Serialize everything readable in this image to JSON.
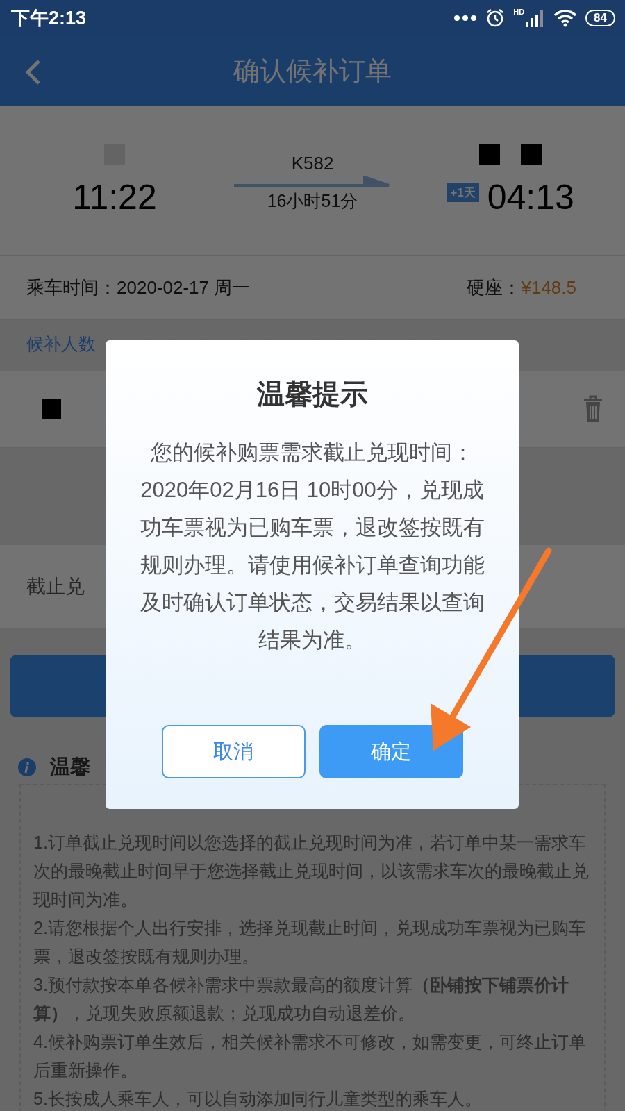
{
  "status_bar": {
    "time": "下午2:13",
    "network": "HD",
    "battery": "84"
  },
  "header": {
    "title": "确认候补订单"
  },
  "train": {
    "number": "K582",
    "depart_time": "11:22",
    "duration": "16小时51分",
    "day_offset": "+1天",
    "arrive_time": "04:13"
  },
  "trip": {
    "date_label": "乘车时间：",
    "date": "2020-02-17 周一",
    "seat_label": "硬座：",
    "price": "¥148.5"
  },
  "passengers_link": "候补人数",
  "deadline_label": "截止兑",
  "notice": {
    "title": "温馨",
    "items": [
      "1.订单截止兑现时间以您选择的截止兑现时间为准，若订单中某一需求车次的最晚截止时间早于您选择截止兑现时间，以该需求车次的最晚截止兑现时间为准。",
      "2.请您根据个人出行安排，选择兑现截止时间，兑现成功车票视为已购车票，退改签按既有规则办理。",
      "3.预付款按本单各候补需求中票款最高的额度计算**（卧铺按下铺票价计算）**，兑现失败原额退款；兑现成功自动退差价。",
      "4.候补购票订单生效后，相关候补需求不可修改，如需变更，可终止订单后重新操作。",
      "5.长按成人乘车人，可以自动添加同行儿童类型的乘车人。"
    ]
  },
  "dialog": {
    "title": "温馨提示",
    "message": "您的候补购票需求截止兑现时间：2020年02月16日 10时00分，兑现成功车票视为已购车票，退改签按既有规则办理。请使用候补订单查询功能及时确认订单状态，交易结果以查询结果为准。",
    "buttons": [
      {
        "label": "取消",
        "kind": "secondary"
      },
      {
        "label": "确定",
        "kind": "primary"
      }
    ]
  }
}
